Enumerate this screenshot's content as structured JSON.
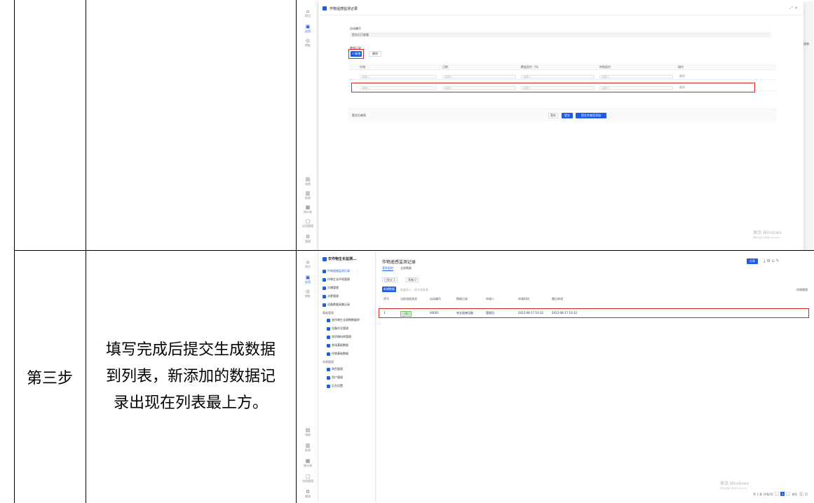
{
  "step": {
    "label": "第三步",
    "description": "填写完成后提交生成数据到列表，新添加的数据记录出现在列表最上方。"
  },
  "rail": [
    "首页",
    "应用",
    "审批",
    "流程",
    "报表",
    "统计表",
    "应用管理",
    "管理"
  ],
  "shot1": {
    "modal_title": "作物遥感监测记录",
    "field_label": "自动编号",
    "field_value": "提交后可查看",
    "table_label": "数据记录",
    "add_btn": "+ 新增",
    "del_btn": "删除",
    "columns": [
      "作物",
      "日期",
      "覆盖面积（%）",
      "种植面积",
      "操作"
    ],
    "placeholder": "请输入",
    "row_action": "删除",
    "checkbox_label": "提交后继续",
    "footer_buttons": [
      "暂存",
      "提交",
      "提交并继续添加"
    ],
    "right_edge": "作物遥感",
    "watermark": "激活 Windows",
    "watermark_sub": "转到\"设置\"以激活 Windows。"
  },
  "shot2": {
    "app_title": "农作物生长监测...",
    "tree_items": [
      "作物遥感监测记录",
      "作物生长环境管理",
      "大棚管理",
      "水肥管理",
      "设备数据采集记录"
    ],
    "tree_group1": "基础管理",
    "tree_items2": [
      "农作物生长周期数据库",
      "设备作业管理",
      "农资物料库管理",
      "农场基础数据",
      "作物基础数据"
    ],
    "tree_group2": "系统管理",
    "tree_items3": [
      "角色管理",
      "用户管理",
      "后台设置"
    ],
    "title": "作物遥感监测记录",
    "tabs": [
      "我发起的",
      "全部数据"
    ],
    "chips": [
      "已提交 1",
      "草稿 0"
    ],
    "new_btn": "新增数据",
    "hint": "批量导入 · 按分组查看",
    "right_link": "作物管理",
    "top_btn": "分享",
    "columns": [
      "序号",
      "当前流程状态",
      "自动编号",
      "数据记录",
      "申请人",
      "申请时间",
      "最后修改"
    ],
    "row": {
      "index": "1",
      "status": "已通过",
      "code": "00001",
      "record": "农业遥感设备",
      "applicant": "管理员",
      "created": "2023-08-17 10:32",
      "modified": "2023-08-17 10:32"
    },
    "pager": {
      "total": "共 1 条",
      "per_page": "10条/页",
      "current": "1",
      "goto": "前往",
      "page_suffix": "页"
    },
    "watermark": "激活 Windows",
    "watermark_sub": "转到\"设置\"以激活 Windows。"
  },
  "colors": {
    "accent": "#1e5ce6",
    "highlight": "#e02424"
  }
}
